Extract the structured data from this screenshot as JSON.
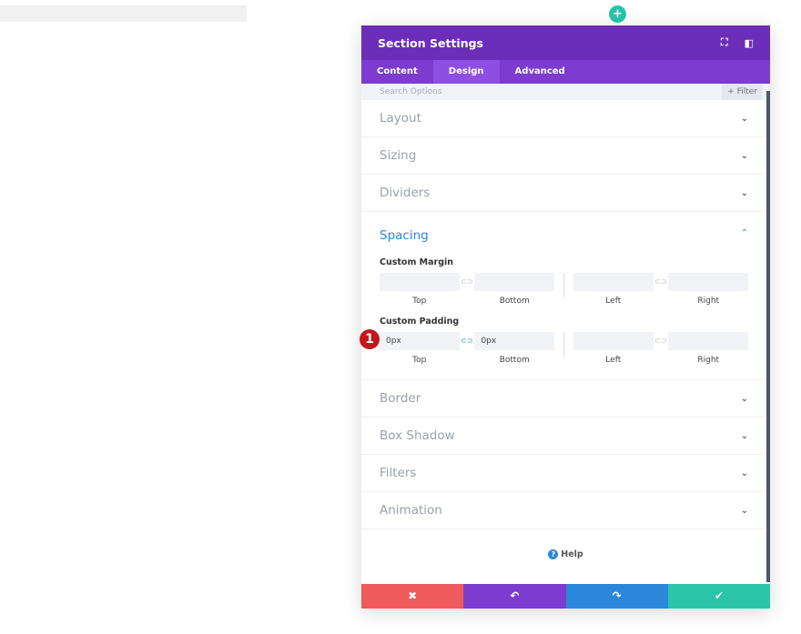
{
  "modal": {
    "title": "Section Settings",
    "tabs": [
      "Content",
      "Design",
      "Advanced"
    ],
    "active_tab": "Design",
    "search_placeholder": "Search Options",
    "filter_label": "+ Filter",
    "groups_before": [
      "Layout",
      "Sizing",
      "Dividers"
    ],
    "spacing": {
      "title": "Spacing",
      "margin_label": "Custom Margin",
      "padding_label": "Custom Padding",
      "captions": [
        "Top",
        "Bottom",
        "Left",
        "Right"
      ],
      "margin_values": [
        "",
        "",
        "",
        ""
      ],
      "padding_values": [
        "0px",
        "0px",
        "",
        ""
      ]
    },
    "groups_after": [
      "Border",
      "Box Shadow",
      "Filters",
      "Animation"
    ],
    "help_label": "Help"
  },
  "annotation": {
    "number": "1",
    "color": "#c5161d"
  },
  "colors": {
    "header": "#6c2eb9",
    "tabs": "#7d3ccf",
    "cancel": "#ef5a5a",
    "undo": "#7e3bd0",
    "redo": "#2b87da",
    "save": "#29c4a9"
  }
}
